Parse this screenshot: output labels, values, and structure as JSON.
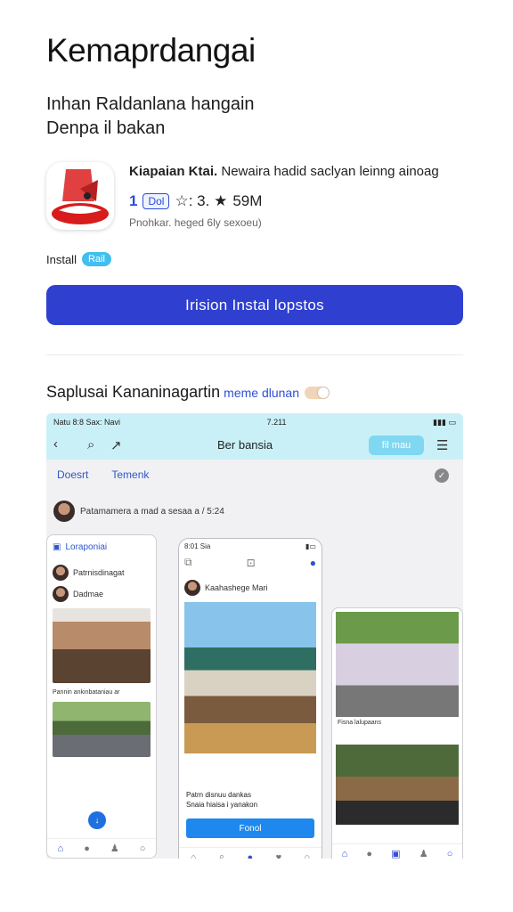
{
  "header": {
    "title": "Kemaprdangai",
    "subtitle_line1": "Inhan Raldanlana hangain",
    "subtitle_line2": "Denpa il bakan"
  },
  "app": {
    "name": "Kiapaian Ktai.",
    "tagline": "Newaira hadid saclyan leinng ainoag",
    "rating_value": "1",
    "rating_badge": "Dol",
    "stars_text": "☆: 3. ★",
    "size": "59M",
    "meta": "Pnohkar. heged 6ly sexoeu)"
  },
  "install": {
    "label": "Install",
    "tag": "Rail",
    "cta_label": "Irision Instal lopstos"
  },
  "section": {
    "title": "Saplusai Kananinagartin",
    "link": "meme dlunan"
  },
  "screenshot": {
    "status_left": "Natu 8:8 Sax: Navi",
    "status_center": "7.211",
    "nav_title": "Ber bansia",
    "nav_pill": "fil mau",
    "tab_1": "Doesrt",
    "tab_2": "Temenk",
    "post_header": "Patamamera a mad a sesaa a / 5:24",
    "p1_header": "Loraponiai",
    "p1_row1": "Patrnisdinagat",
    "p1_row2": "Dadmae",
    "p1_caption": "Pannin ankinbataniau ar",
    "p2_status": "8:01 Sia",
    "p2_post": "Kaahashege Mari",
    "p2_cap1": "Patrn disnuu dankas",
    "p2_cap2": "Snaia hiaisa i yanakon",
    "p2_btn": "Fonol",
    "p3_caption": "Fisna lalupaans"
  },
  "colors": {
    "accent": "#2f3fd0",
    "install_tag": "#40bff0",
    "screenshot_header": "#c9f0f7"
  }
}
